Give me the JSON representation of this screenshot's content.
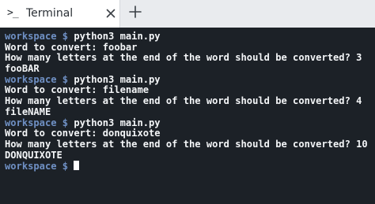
{
  "tab": {
    "icon": ">_",
    "title": "Terminal"
  },
  "terminal": {
    "prompt": "workspace $",
    "lines": [
      {
        "type": "prompt",
        "command": "python3 main.py"
      },
      {
        "type": "output",
        "text": "Word to convert: foobar"
      },
      {
        "type": "output",
        "text": "How many letters at the end of the word should be converted? 3"
      },
      {
        "type": "output",
        "text": "fooBAR"
      },
      {
        "type": "prompt",
        "command": "python3 main.py"
      },
      {
        "type": "output",
        "text": "Word to convert: filename"
      },
      {
        "type": "output",
        "text": "How many letters at the end of the word should be converted? 4"
      },
      {
        "type": "output",
        "text": "fileNAME"
      },
      {
        "type": "prompt",
        "command": "python3 main.py"
      },
      {
        "type": "output",
        "text": "Word to convert: donquixote"
      },
      {
        "type": "output",
        "text": "How many letters at the end of the word should be converted? 10"
      },
      {
        "type": "output",
        "text": "DONQUIXOTE"
      },
      {
        "type": "prompt",
        "command": ""
      }
    ]
  },
  "colors": {
    "background": "#1c2127",
    "prompt": "#6f90c4",
    "text": "#f4f6f8"
  }
}
